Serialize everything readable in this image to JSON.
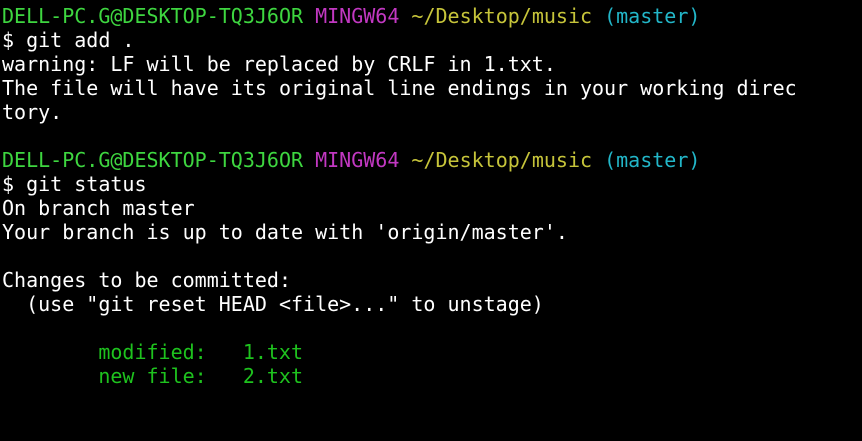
{
  "window": {
    "kind": "Git Bash terminal (MINGW64)"
  },
  "prompt1": {
    "user_host": "DELL-PC.G@DESKTOP-TQ3J6OR",
    "env": "MINGW64",
    "path": "~/Desktop/music",
    "branch": "(master)",
    "command": "$ git add ."
  },
  "output1": {
    "line1": "warning: LF will be replaced by CRLF in 1.txt.",
    "line2": "The file will have its original line endings in your working direc",
    "line3": "tory."
  },
  "prompt2": {
    "user_host": "DELL-PC.G@DESKTOP-TQ3J6OR",
    "env": "MINGW64",
    "path": "~/Desktop/music",
    "branch": "(master)",
    "command": "$ git status"
  },
  "status": {
    "branch_line": "On branch master",
    "up_to_date_line": "Your branch is up to date with 'origin/master'.",
    "changes_header": "Changes to be committed:",
    "hint": "(use \"git reset HEAD <file>...\" to unstage)",
    "files": [
      {
        "state": "modified:",
        "name": "1.txt"
      },
      {
        "state": "new file:",
        "name": "2.txt"
      }
    ]
  },
  "colors": {
    "background": "#000000",
    "user_host": "#3ed640",
    "env": "#c238c2",
    "path": "#c6c43a",
    "branch": "#22b6c8",
    "text": "#ffffff",
    "staged_files": "#1ec21e"
  }
}
